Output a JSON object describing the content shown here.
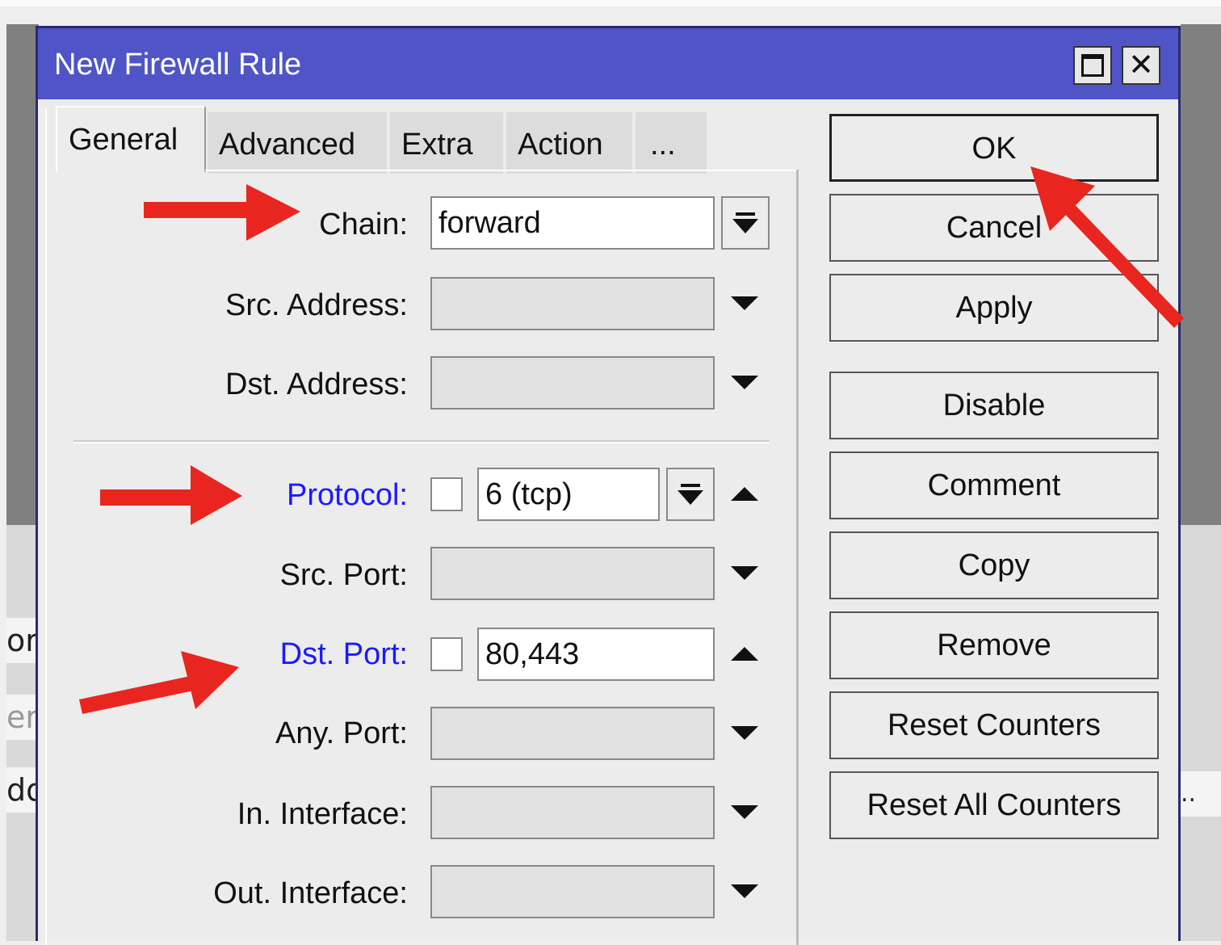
{
  "dialog": {
    "title": "New Firewall Rule",
    "close_glyph": "✕"
  },
  "tabs": [
    {
      "label": "General",
      "active": true
    },
    {
      "label": "Advanced"
    },
    {
      "label": "Extra"
    },
    {
      "label": "Action"
    },
    {
      "label": "..."
    }
  ],
  "fields": {
    "chain": {
      "label": "Chain:",
      "value": "forward"
    },
    "src_address": {
      "label": "Src. Address:",
      "value": ""
    },
    "dst_address": {
      "label": "Dst. Address:",
      "value": ""
    },
    "protocol": {
      "label": "Protocol:",
      "value": "6 (tcp)"
    },
    "src_port": {
      "label": "Src. Port:",
      "value": ""
    },
    "dst_port": {
      "label": "Dst. Port:",
      "value": "80,443"
    },
    "any_port": {
      "label": "Any. Port:",
      "value": ""
    },
    "in_interface": {
      "label": "In. Interface:",
      "value": ""
    },
    "out_interface": {
      "label": "Out. Interface:",
      "value": ""
    }
  },
  "buttons": {
    "ok": "OK",
    "cancel": "Cancel",
    "apply": "Apply",
    "disable": "Disable",
    "comment": "Comment",
    "copy": "Copy",
    "remove": "Remove",
    "reset_counters": "Reset Counters",
    "reset_all_counters": "Reset All Counters"
  },
  "background": {
    "left_fragments": [
      "or",
      "er",
      "dd"
    ],
    "right_fragment": ".."
  },
  "colors": {
    "titlebar": "#4f55c6",
    "annotation_arrow": "#e8261f",
    "link_label": "#1a1aff"
  }
}
